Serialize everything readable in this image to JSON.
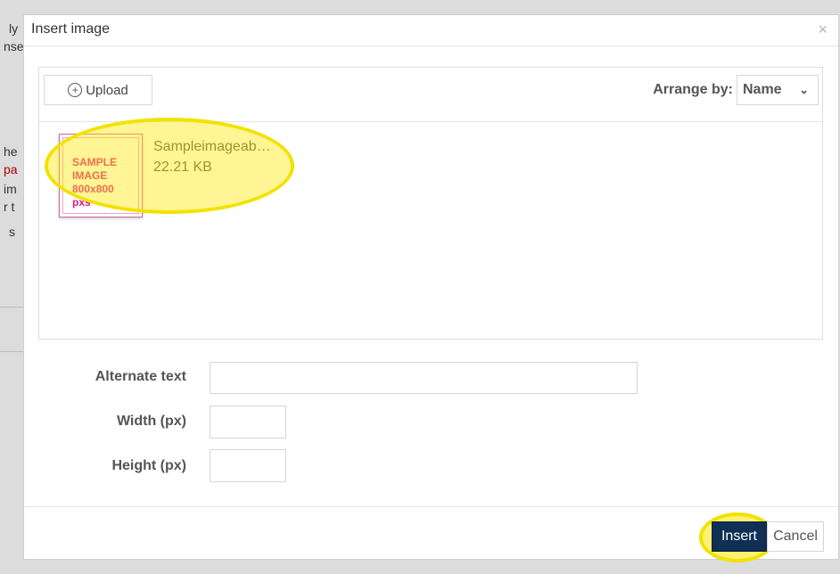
{
  "dialog": {
    "title": "Insert image",
    "close_icon": "close-icon"
  },
  "background_fragments": [
    "ly",
    "nse",
    "he",
    "pa",
    "im",
    "r t",
    "s"
  ],
  "toolbar": {
    "upload_label": "Upload",
    "upload_icon": "plus-circle-icon",
    "arrange_label": "Arrange by:",
    "arrange_value": "Name",
    "arrange_icon": "chevron-down-icon"
  },
  "files": [
    {
      "name": "Sampleimageab…",
      "size": "22.21 KB",
      "thumb_lines": [
        "SAMPLE",
        "IMAGE",
        "800x800",
        "pxs"
      ]
    }
  ],
  "form": {
    "alt_label": "Alternate text",
    "alt_value": "",
    "width_label": "Width (px)",
    "width_value": "",
    "height_label": "Height (px)",
    "height_value": ""
  },
  "footer": {
    "insert_label": "Insert",
    "cancel_label": "Cancel"
  },
  "colors": {
    "highlight": "#f2e200",
    "insert_button": "#0f2f54",
    "thumb_text": "#e0168a"
  }
}
